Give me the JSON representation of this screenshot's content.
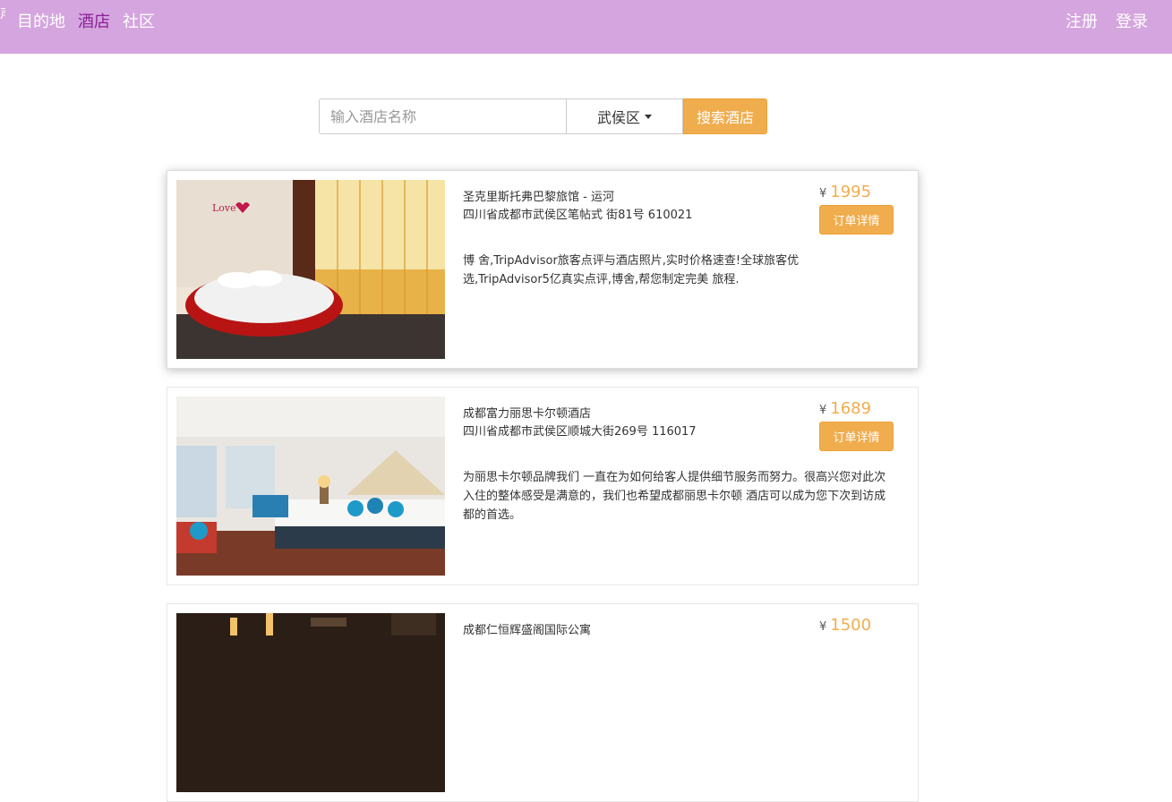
{
  "nav": {
    "logo": "声",
    "links": [
      "目的地",
      "酒店",
      "社区"
    ],
    "right": [
      "注册",
      "登录"
    ],
    "active_color": "#8b1f97",
    "bar_color": "#d4a5de"
  },
  "search": {
    "placeholder": "输入酒店名称",
    "district": "武侯区",
    "button": "搜索酒店"
  },
  "currency": "¥",
  "order_button": "订单详情",
  "hotels": [
    {
      "name": "圣克里斯托弗巴黎旅馆 - 运河",
      "address": "四川省成都市武侯区笔帖式  街81号 610021",
      "price": "1995",
      "description": "博  舍,TripAdvisor旅客点评与酒店照片,实时价格速查!全球旅客优选,TripAdvisor5亿真实点评,博舍,帮您制定完美  旅程."
    },
    {
      "name": "成都富力丽思卡尔顿酒店",
      "address": "四川省成都市武侯区顺城大街269号 116017",
      "price": "1689",
      "description": "为丽思卡尔顿品牌我们  一直在为如何给客人提供细节服务而努力。很高兴您对此次入住的整体感受是满意的，我们也希望成都丽思卡尔顿  酒店可以成为您下次到访成都的首选。"
    },
    {
      "name": "成都仁恒辉盛阁国际公寓",
      "address": "",
      "price": "1500",
      "description": ""
    }
  ]
}
